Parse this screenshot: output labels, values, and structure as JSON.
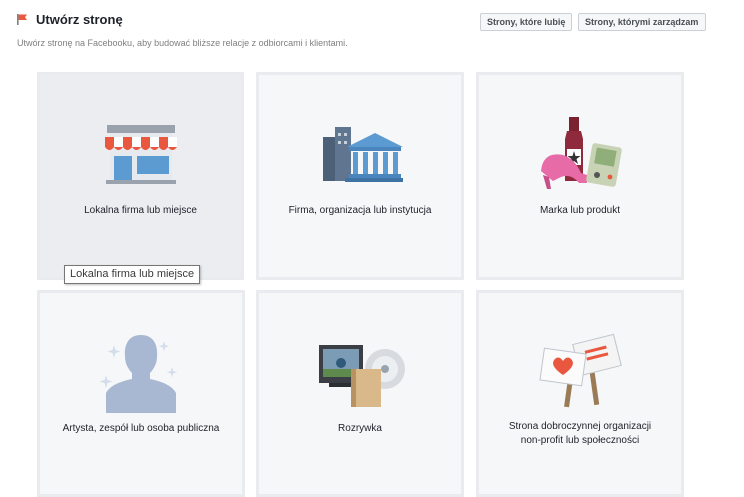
{
  "header": {
    "title": "Utwórz stronę",
    "subtitle": "Utwórz stronę na Facebooku, aby budować bliższe relacje z odbiorcami i klientami.",
    "buttons": {
      "liked_pages": "Strony, które lubię",
      "managed_pages": "Strony, którymi zarządzam"
    }
  },
  "categories": [
    {
      "label": "Lokalna firma lub miejsce",
      "icon": "storefront-icon"
    },
    {
      "label": "Firma, organizacja lub instytucja",
      "icon": "office-buildings-icon"
    },
    {
      "label": "Marka lub produkt",
      "icon": "brand-products-icon"
    },
    {
      "label": "Artysta, zespół lub osoba publiczna",
      "icon": "public-figure-icon"
    },
    {
      "label": "Rozrywka",
      "icon": "entertainment-icon"
    },
    {
      "label": "Strona dobroczynnej organizacji non-profit lub społeczności",
      "icon": "charity-signs-icon"
    }
  ],
  "tooltip": "Lokalna firma lub miejsce",
  "colors": {
    "accent_red": "#e9573f",
    "tile_bg": "#f6f7f9",
    "tile_border": "#e9ebee",
    "awning_blue": "#5b9bd1"
  }
}
